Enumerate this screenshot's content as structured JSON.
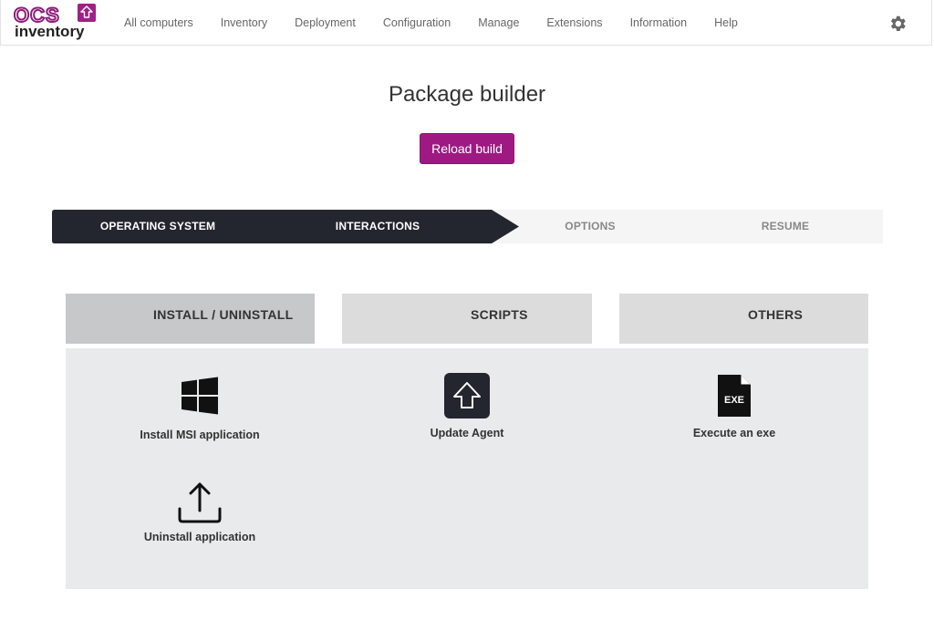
{
  "logo": {
    "top": "OCS",
    "bottom": "inventory"
  },
  "nav": {
    "items": [
      {
        "label": "All computers"
      },
      {
        "label": "Inventory"
      },
      {
        "label": "Deployment"
      },
      {
        "label": "Configuration"
      },
      {
        "label": "Manage"
      },
      {
        "label": "Extensions"
      },
      {
        "label": "Information"
      },
      {
        "label": "Help"
      }
    ]
  },
  "page": {
    "title": "Package builder",
    "reload_label": "Reload build"
  },
  "steps": [
    {
      "label": "OPERATING SYSTEM",
      "state": "done"
    },
    {
      "label": "INTERACTIONS",
      "state": "current"
    },
    {
      "label": "OPTIONS",
      "state": "todo"
    },
    {
      "label": "RESUME",
      "state": "todo"
    }
  ],
  "tabs": [
    {
      "label": "INSTALL / UNINSTALL",
      "active": true
    },
    {
      "label": "SCRIPTS",
      "active": false
    },
    {
      "label": "OTHERS",
      "active": false
    }
  ],
  "actions": [
    {
      "label": "Install MSI application",
      "icon": "windows-icon"
    },
    {
      "label": "Update Agent",
      "icon": "upload-arrow-icon"
    },
    {
      "label": "Execute an exe",
      "icon": "exe-file-icon",
      "icon_text": "EXE"
    },
    {
      "label": "Uninstall application",
      "icon": "upload-tray-icon"
    }
  ],
  "colors": {
    "accent": "#9e1a82",
    "stepper_dark": "#23252f",
    "panel": "#e9eaeb"
  }
}
